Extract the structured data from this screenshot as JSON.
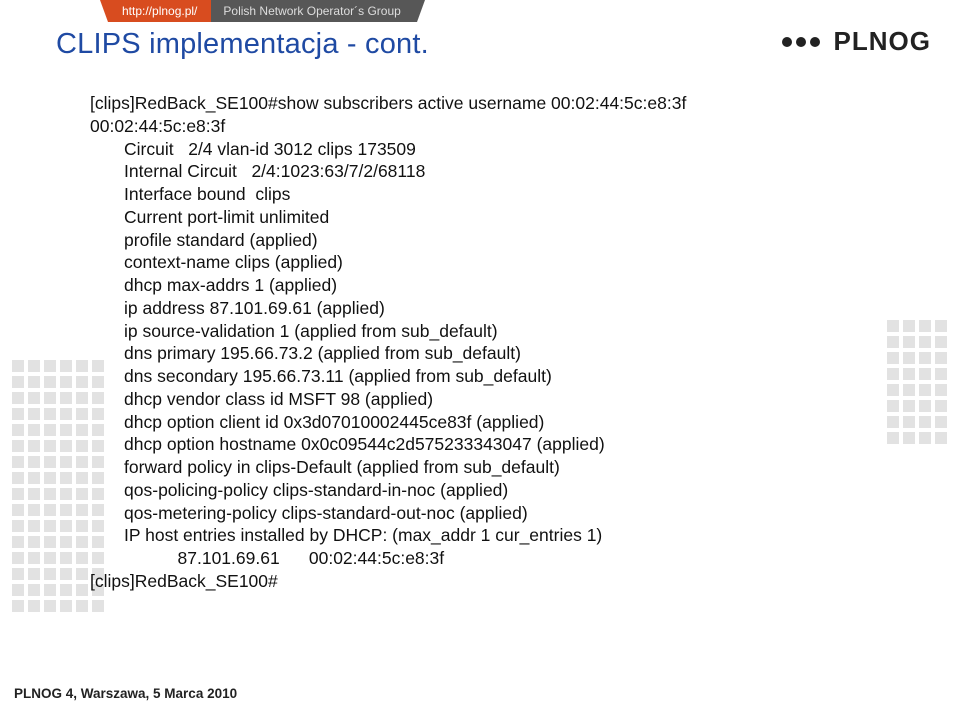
{
  "header": {
    "url": "http://plnog.pl/",
    "group": "Polish Network Operator´s Group",
    "logo": "PLNOG"
  },
  "title": "CLIPS implementacja - cont.",
  "cli": {
    "lines": [
      "[clips]RedBack_SE100#show subscribers active username 00:02:44:5c:e8:3f",
      "00:02:44:5c:e8:3f",
      "       Circuit   2/4 vlan-id 3012 clips 173509",
      "       Internal Circuit   2/4:1023:63/7/2/68118",
      "       Interface bound  clips",
      "       Current port-limit unlimited",
      "       profile standard (applied)",
      "       context-name clips (applied)",
      "       dhcp max-addrs 1 (applied)",
      "       ip address 87.101.69.61 (applied)",
      "       ip source-validation 1 (applied from sub_default)",
      "       dns primary 195.66.73.2 (applied from sub_default)",
      "       dns secondary 195.66.73.11 (applied from sub_default)",
      "       dhcp vendor class id MSFT 98 (applied)",
      "       dhcp option client id 0x3d07010002445ce83f (applied)",
      "       dhcp option hostname 0x0c09544c2d575233343047 (applied)",
      "       forward policy in clips-Default (applied from sub_default)",
      "       qos-policing-policy clips-standard-in-noc (applied)",
      "       qos-metering-policy clips-standard-out-noc (applied)",
      "       IP host entries installed by DHCP: (max_addr 1 cur_entries 1)",
      "                  87.101.69.61      00:02:44:5c:e8:3f",
      "[clips]RedBack_SE100#"
    ]
  },
  "footer": "PLNOG 4, Warszawa, 5 Marca 2010"
}
